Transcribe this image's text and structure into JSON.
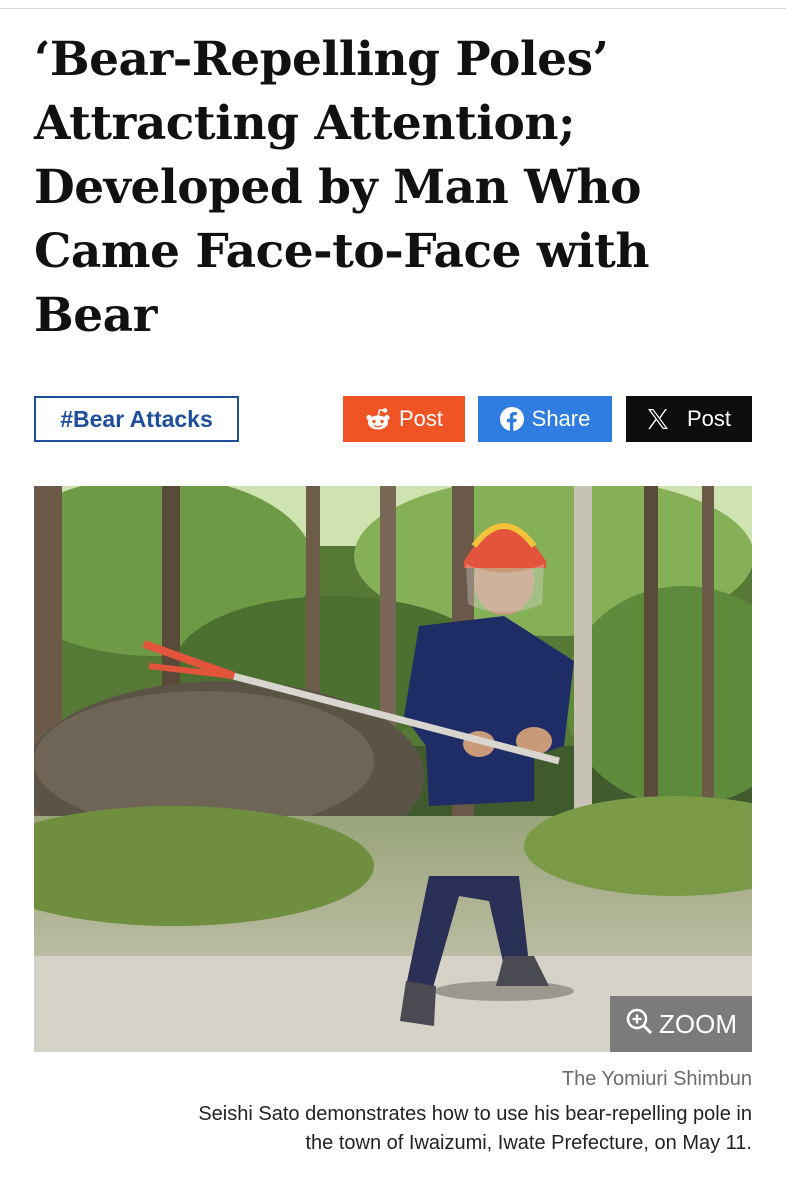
{
  "article": {
    "headline": "‘Bear-Repelling Poles’\nAttracting Attention;\nDeveloped by Man Who\nCame Face-to-Face with\nBear",
    "tag": "#Bear Attacks"
  },
  "share": {
    "reddit": {
      "label": "Post",
      "icon": "reddit-icon",
      "color": "#f05424"
    },
    "facebook": {
      "label": "Share",
      "icon": "facebook-icon",
      "color": "#2f7de1"
    },
    "x": {
      "label": "Post",
      "icon": "x-icon",
      "color": "#0d0d0d"
    }
  },
  "photo": {
    "zoom_label": "ZOOM",
    "zoom_icon": "zoom-in-icon",
    "credit": "The Yomiuri Shimbun",
    "caption": "Seishi Sato demonstrates how to use his bear-repelling pole in the town of Iwaizumi, Iwate Prefecture, on May 11."
  }
}
